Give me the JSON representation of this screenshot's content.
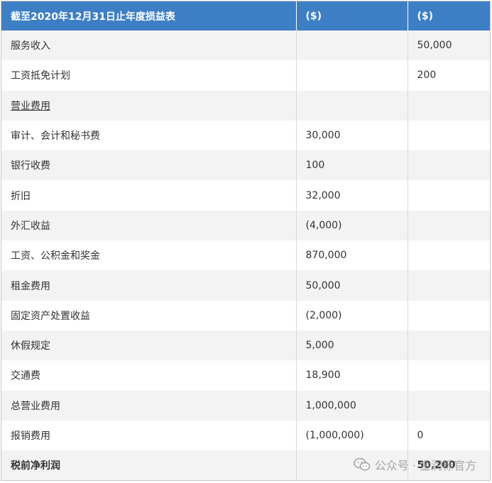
{
  "table": {
    "headers": [
      "截至2020年12月31日止年度损益表",
      "($)",
      "($)"
    ],
    "rows": [
      {
        "label": "服务收入",
        "col2": "",
        "col3": "50,000",
        "style": ""
      },
      {
        "label": "工资抵免计划",
        "col2": "",
        "col3": "200",
        "style": ""
      },
      {
        "label": "营业费用",
        "col2": "",
        "col3": "",
        "style": "underline"
      },
      {
        "label": "审计、会计和秘书费",
        "col2": "30,000",
        "col3": "",
        "style": ""
      },
      {
        "label": "银行收费",
        "col2": "100",
        "col3": "",
        "style": ""
      },
      {
        "label": "折旧",
        "col2": "32,000",
        "col3": "",
        "style": ""
      },
      {
        "label": "外汇收益",
        "col2": "(4,000)",
        "col3": "",
        "style": ""
      },
      {
        "label": "工资、公积金和奖金",
        "col2": "870,000",
        "col3": "",
        "style": ""
      },
      {
        "label": "租金费用",
        "col2": "50,000",
        "col3": "",
        "style": ""
      },
      {
        "label": "固定资产处置收益",
        "col2": "(2,000)",
        "col3": "",
        "style": ""
      },
      {
        "label": "休假规定",
        "col2": "5,000",
        "col3": "",
        "style": ""
      },
      {
        "label": "交通费",
        "col2": "18,900",
        "col3": "",
        "style": ""
      },
      {
        "label": "总营业费用",
        "col2": "1,000,000",
        "col3": "",
        "style": ""
      },
      {
        "label": "报销费用",
        "col2": "(1,000,000)",
        "col3": "0",
        "style": ""
      },
      {
        "label": "税前净利润",
        "col2": "",
        "col3": "50,200",
        "style": "bold"
      }
    ]
  },
  "watermark": {
    "text": "公众号 · 金润栎官方",
    "icon": "wechat-icon"
  },
  "colors": {
    "header_bg": "#3d7fc4",
    "row_alt": "#f3f3f3"
  }
}
